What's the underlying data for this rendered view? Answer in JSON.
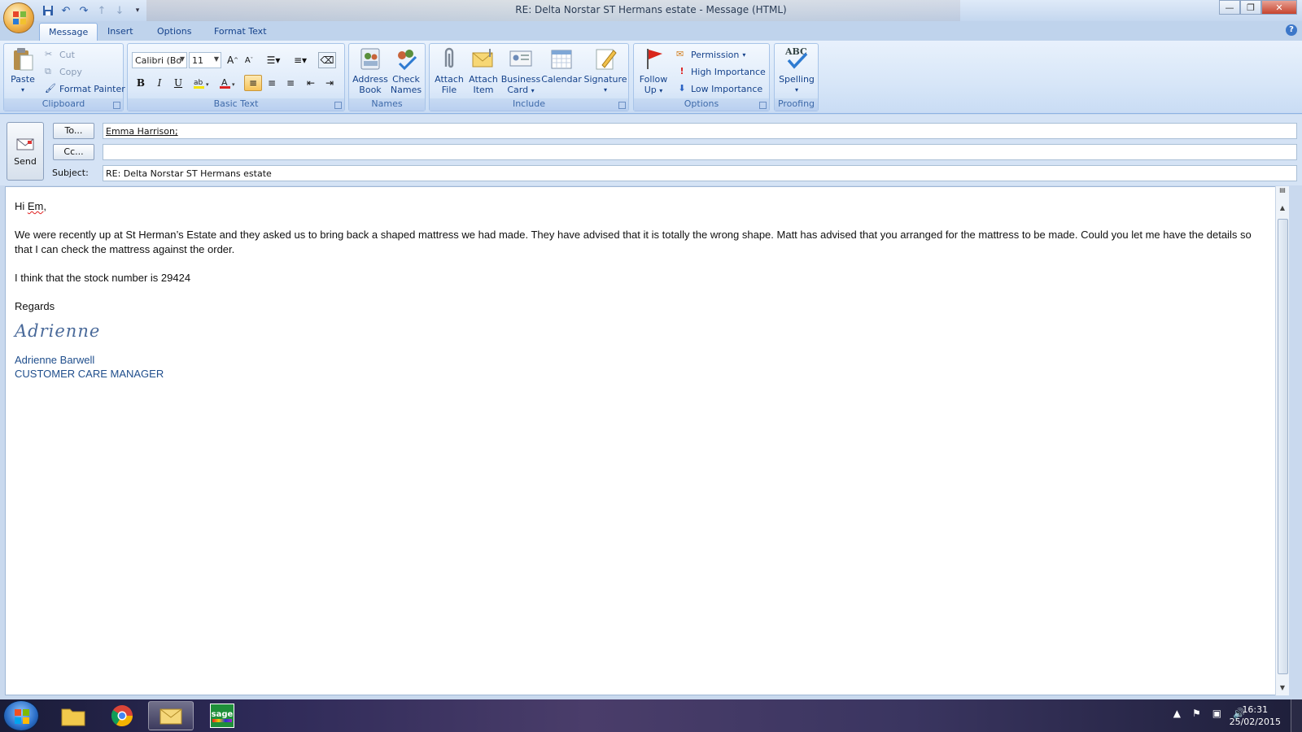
{
  "window": {
    "title": "RE: Delta Norstar ST Hermans estate - Message (HTML)"
  },
  "quick_access": {
    "icons": [
      "save-icon",
      "undo-icon",
      "redo-icon",
      "up-arrow-icon",
      "down-arrow-icon",
      "customize-icon"
    ]
  },
  "ribbon": {
    "tabs": [
      {
        "label": "Message"
      },
      {
        "label": "Insert"
      },
      {
        "label": "Options"
      },
      {
        "label": "Format Text"
      }
    ],
    "clipboard": {
      "group_label": "Clipboard",
      "paste": "Paste",
      "cut": "Cut",
      "copy": "Copy",
      "format_painter": "Format Painter"
    },
    "basic_text": {
      "group_label": "Basic Text",
      "font": "Calibri (Bo",
      "size": "11",
      "bold": "B",
      "italic": "I",
      "underline": "U"
    },
    "names": {
      "group_label": "Names",
      "address_book_1": "Address",
      "address_book_2": "Book",
      "check_names_1": "Check",
      "check_names_2": "Names"
    },
    "include": {
      "group_label": "Include",
      "attach_file_1": "Attach",
      "attach_file_2": "File",
      "attach_item_1": "Attach",
      "attach_item_2": "Item",
      "business_card_1": "Business",
      "business_card_2": "Card",
      "calendar": "Calendar",
      "signature": "Signature"
    },
    "options": {
      "group_label": "Options",
      "follow_up_1": "Follow",
      "follow_up_2": "Up",
      "permission": "Permission",
      "high_importance": "High Importance",
      "low_importance": "Low Importance"
    },
    "proofing": {
      "group_label": "Proofing",
      "spelling": "Spelling",
      "abc": "ABC"
    }
  },
  "header": {
    "send": "Send",
    "to_button": "To...",
    "cc_button": "Cc...",
    "subject_label": "Subject:",
    "to_value": "Emma Harrison;",
    "cc_value": "",
    "subject_value": "RE: Delta Norstar ST Hermans estate"
  },
  "body": {
    "greeting_prefix": "Hi ",
    "greeting_name": "Em",
    "greeting_suffix": ",",
    "paragraph1": "We were recently up at St Herman’s Estate and they asked us to bring back a shaped mattress we had made.  They  have advised that it is totally the wrong shape.  Matt has advised that you arranged for the mattress to be made.  Could you let me have the details so that I can check the mattress against the order.",
    "paragraph2": "I think that the stock number is 29424",
    "closing": "Regards",
    "signature_script": "Adrienne",
    "signature_name": "Adrienne Barwell",
    "signature_title": "CUSTOMER CARE MANAGER"
  },
  "taskbar": {
    "time": "16:31",
    "date": "25/02/2015",
    "sage_label": "sage"
  },
  "colors": {
    "ribbon_bg": "#d7e6f8",
    "accent": "#15428b",
    "signature": "#1f4e8c"
  }
}
